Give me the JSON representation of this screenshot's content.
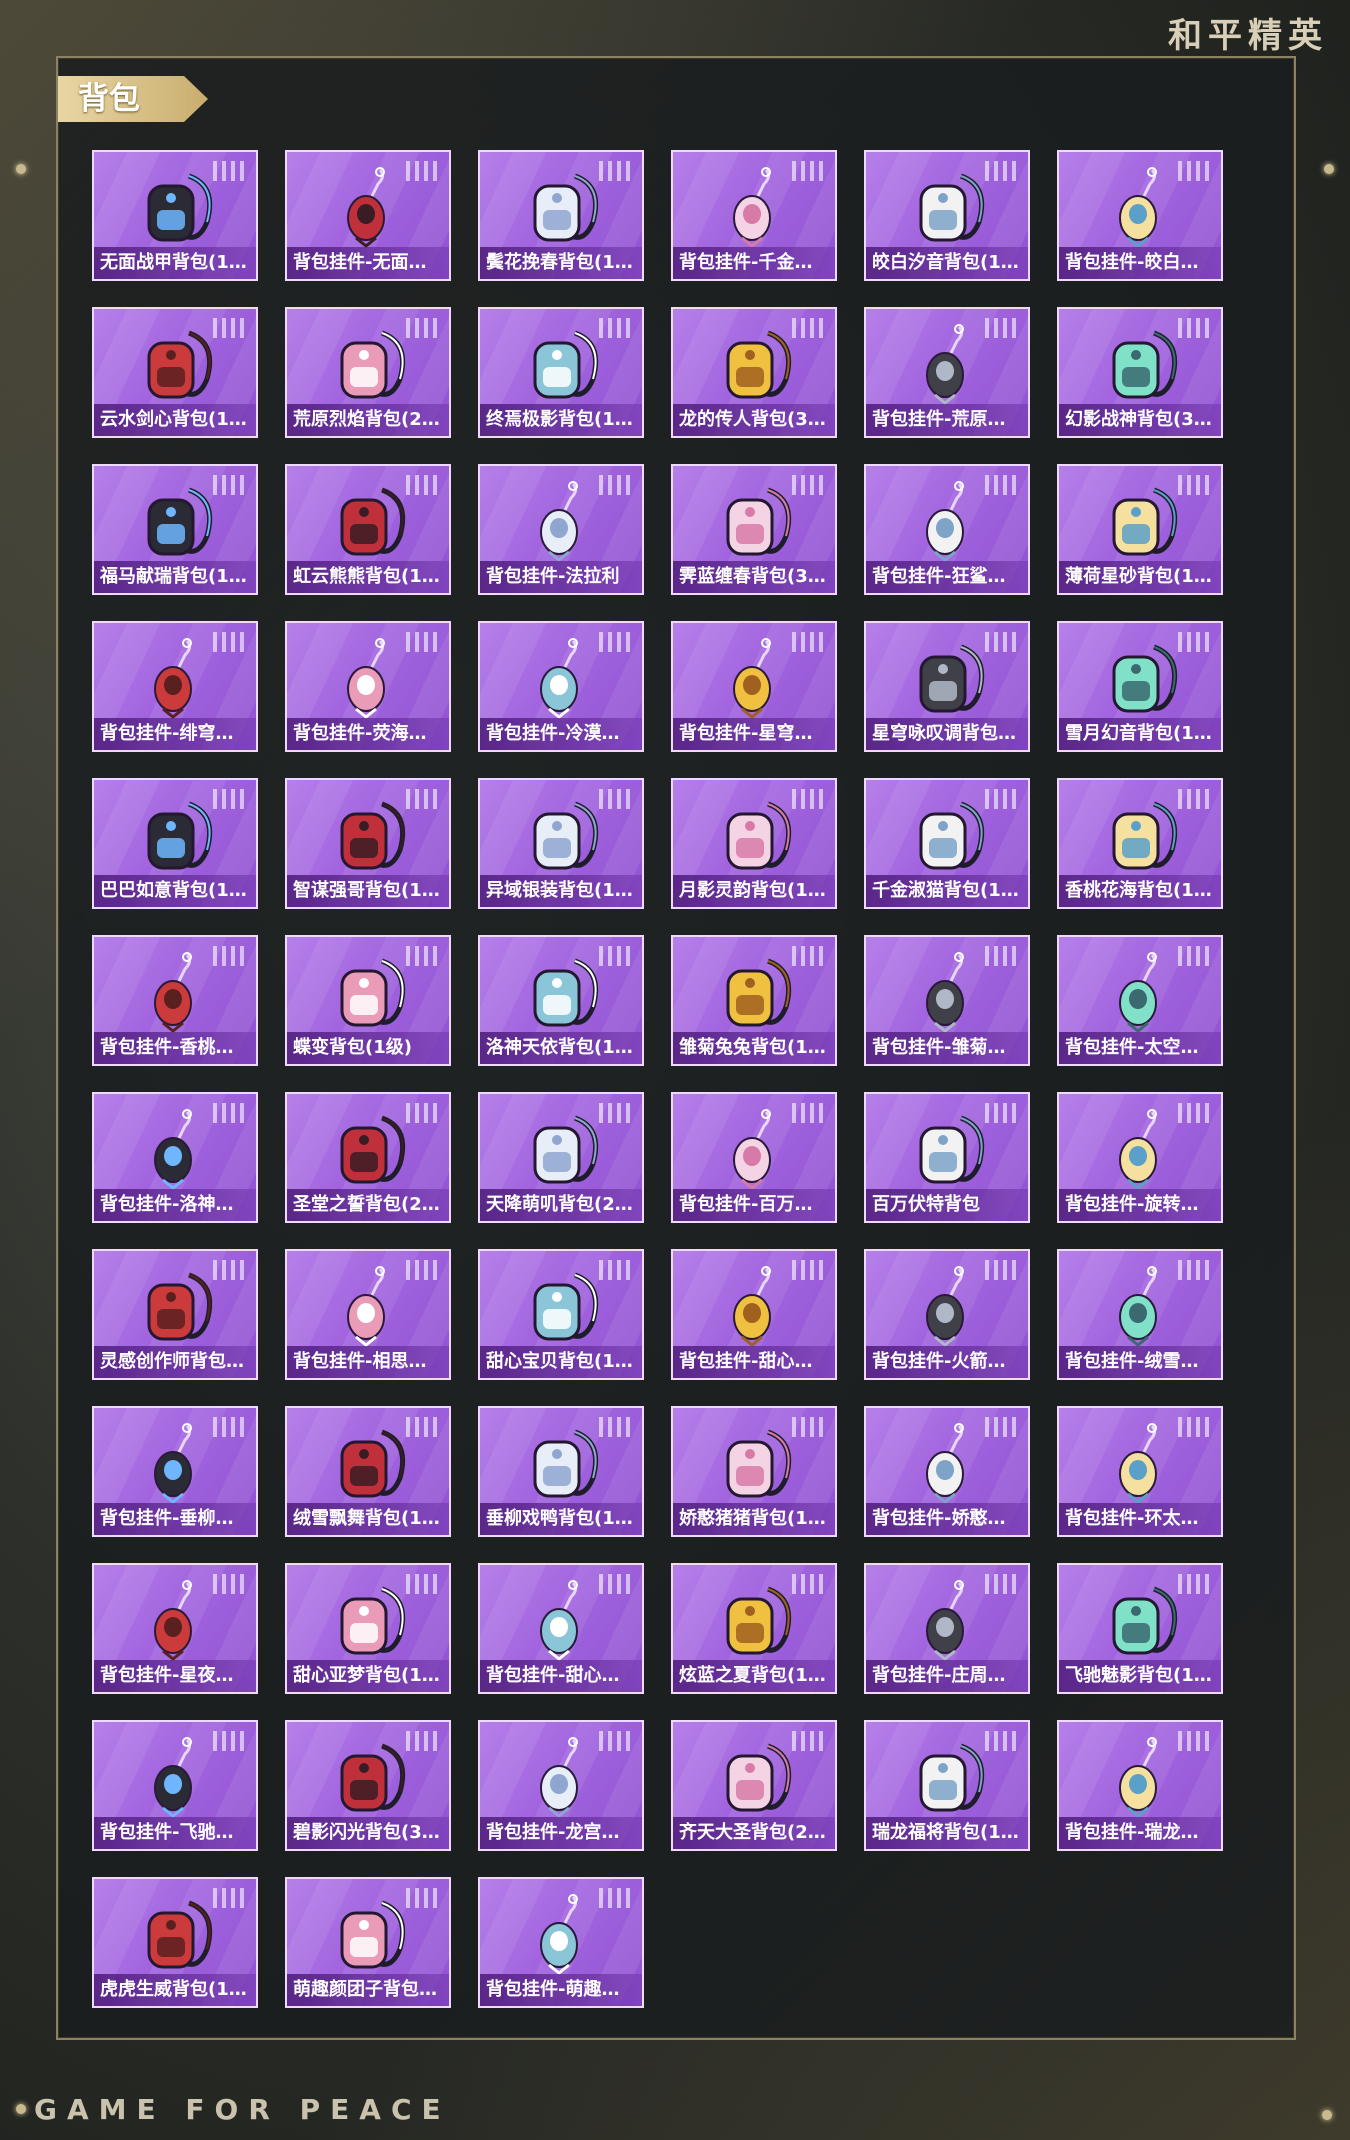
{
  "brand": "和平精英",
  "tagline": "GAME FOR PEACE",
  "section_title": "背包",
  "colors": {
    "card_purple": "#a265df",
    "gold": "#c9ad6e"
  },
  "items": [
    {
      "label": "无面战甲背包(1…",
      "icon": "armor-backpack-icon"
    },
    {
      "label": "背包挂件-无面…",
      "icon": "mask-pendant-icon"
    },
    {
      "label": "鬓花挽春背包(1…",
      "icon": "flower-backpack-icon"
    },
    {
      "label": "背包挂件-千金…",
      "icon": "cat-pendant-icon"
    },
    {
      "label": "皎白汐音背包(1…",
      "icon": "orb-backpack-icon"
    },
    {
      "label": "背包挂件-皎白…",
      "icon": "swirl-pendant-icon"
    },
    {
      "label": "云水剑心背包(1…",
      "icon": "sword-backpack-icon"
    },
    {
      "label": "荒原烈焰背包(2…",
      "icon": "flame-backpack-icon"
    },
    {
      "label": "终焉极影背包(1…",
      "icon": "shadow-backpack-icon"
    },
    {
      "label": "龙的传人背包(3…",
      "icon": "dragon-backpack-icon"
    },
    {
      "label": "背包挂件-荒原…",
      "icon": "star-pendant-icon"
    },
    {
      "label": "幻影战神背包(3…",
      "icon": "mech-backpack-icon"
    },
    {
      "label": "福马献瑞背包(1…",
      "icon": "horse-backpack-icon"
    },
    {
      "label": "虹云熊熊背包(1…",
      "icon": "bear-backpack-icon"
    },
    {
      "label": "背包挂件-法拉利",
      "icon": "ferrari-pendant-icon"
    },
    {
      "label": "霁蓝缠春背包(3…",
      "icon": "ornament-backpack-icon"
    },
    {
      "label": "背包挂件-狂鲨…",
      "icon": "fin-pendant-icon"
    },
    {
      "label": "薄荷星砂背包(1…",
      "icon": "mint-backpack-icon"
    },
    {
      "label": "背包挂件-绯穹…",
      "icon": "feather-pendant-icon"
    },
    {
      "label": "背包挂件-荧海…",
      "icon": "drink-pendant-icon"
    },
    {
      "label": "背包挂件-冷漠…",
      "icon": "shell-pendant-icon"
    },
    {
      "label": "背包挂件-星穹…",
      "icon": "dreamcatcher-pendant-icon"
    },
    {
      "label": "星穹咏叹调背包…",
      "icon": "bunny-backpack-icon"
    },
    {
      "label": "雪月幻音背包(1…",
      "icon": "moon-backpack-icon"
    },
    {
      "label": "巴巴如意背包(1…",
      "icon": "egg-backpack-icon"
    },
    {
      "label": "智谋强哥背包(1…",
      "icon": "cookie-backpack-icon"
    },
    {
      "label": "异域银装背包(1…",
      "icon": "black-backpack-icon"
    },
    {
      "label": "月影灵韵背包(1…",
      "icon": "moon-face-backpack-icon"
    },
    {
      "label": "千金淑猫背包(1…",
      "icon": "cat-backpack-icon"
    },
    {
      "label": "香桃花海背包(1…",
      "icon": "peach-backpack-icon"
    },
    {
      "label": "背包挂件-香桃…",
      "icon": "blossom-pendant-icon"
    },
    {
      "label": "蝶变背包(1级)",
      "icon": "butterfly-backpack-icon"
    },
    {
      "label": "洛神天依背包(1…",
      "icon": "crystal-backpack-icon"
    },
    {
      "label": "雏菊兔兔背包(1…",
      "icon": "daisy-backpack-icon"
    },
    {
      "label": "背包挂件-雏菊…",
      "icon": "rabbit-pendant-icon"
    },
    {
      "label": "背包挂件-太空…",
      "icon": "astronaut-pendant-icon"
    },
    {
      "label": "背包挂件-洛神…",
      "icon": "bow-pendant-icon"
    },
    {
      "label": "圣堂之誓背包(2…",
      "icon": "wing-backpack-icon"
    },
    {
      "label": "天降萌叽背包(2…",
      "icon": "gold-backpack-icon"
    },
    {
      "label": "背包挂件-百万…",
      "icon": "bat-pendant-icon"
    },
    {
      "label": "百万伏特背包",
      "icon": "volt-backpack-icon"
    },
    {
      "label": "背包挂件-旋转…",
      "icon": "unicorn-pendant-icon"
    },
    {
      "label": "灵感创作师背包…",
      "icon": "pouch-backpack-icon"
    },
    {
      "label": "背包挂件-相思…",
      "icon": "gem-pendant-icon"
    },
    {
      "label": "甜心宝贝背包(1…",
      "icon": "milk-backpack-icon"
    },
    {
      "label": "背包挂件-甜心…",
      "icon": "lollipop-pendant-icon"
    },
    {
      "label": "背包挂件-火箭…",
      "icon": "rocket-pendant-icon"
    },
    {
      "label": "背包挂件-绒雪…",
      "icon": "jellyfish-pendant-icon"
    },
    {
      "label": "背包挂件-垂柳…",
      "icon": "duck-pendant-icon"
    },
    {
      "label": "绒雪飘舞背包(1…",
      "icon": "snow-backpack-icon"
    },
    {
      "label": "垂柳戏鸭背包(1…",
      "icon": "duck-backpack-icon"
    },
    {
      "label": "娇憨猪猪背包(1…",
      "icon": "pig-backpack-icon"
    },
    {
      "label": "背包挂件-娇憨…",
      "icon": "piggy-pendant-icon"
    },
    {
      "label": "背包挂件-环太…",
      "icon": "robot-pendant-icon"
    },
    {
      "label": "背包挂件-星夜…",
      "icon": "batwing-pendant-icon"
    },
    {
      "label": "甜心亚梦背包(1…",
      "icon": "cake-backpack-icon"
    },
    {
      "label": "背包挂件-甜心…",
      "icon": "paw-pendant-icon"
    },
    {
      "label": "炫蓝之夏背包(1…",
      "icon": "summer-backpack-icon"
    },
    {
      "label": "背包挂件-庄周…",
      "icon": "butterfly-pendant-icon"
    },
    {
      "label": "飞驰魅影背包(1…",
      "icon": "speed-backpack-icon"
    },
    {
      "label": "背包挂件-飞驰…",
      "icon": "eye-pendant-icon"
    },
    {
      "label": "碧影闪光背包(3…",
      "icon": "mecha-backpack-icon"
    },
    {
      "label": "背包挂件-龙宫…",
      "icon": "knot-pendant-icon"
    },
    {
      "label": "齐天大圣背包(2…",
      "icon": "monkey-king-backpack-icon"
    },
    {
      "label": "瑞龙福将背包(1…",
      "icon": "dragon-armor-backpack-icon"
    },
    {
      "label": "背包挂件-瑞龙…",
      "icon": "lantern-pendant-icon"
    },
    {
      "label": "虎虎生威背包(1…",
      "icon": "tiger-backpack-icon"
    },
    {
      "label": "萌趣颜团子背包…",
      "icon": "dumpling-backpack-icon"
    },
    {
      "label": "背包挂件-萌趣…",
      "icon": "sprout-pendant-icon"
    }
  ]
}
